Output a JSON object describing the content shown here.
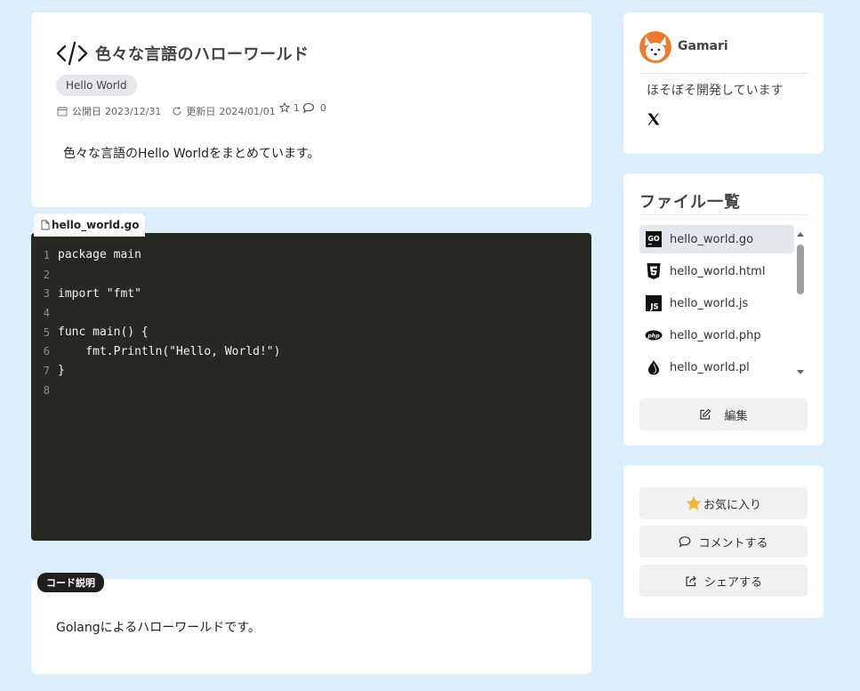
{
  "post": {
    "title": "色々な言語のハローワールド",
    "tag": "Hello World",
    "published_label": "公開日",
    "published_date": "2023/12/31",
    "updated_label": "更新日",
    "updated_date": "2024/01/01",
    "star_count": "1",
    "comment_count": "0",
    "description": "色々な言語のHello Worldをまとめています。"
  },
  "code": {
    "filename": "hello_world.go",
    "lines": [
      {
        "num": "1",
        "text": "package main"
      },
      {
        "num": "2",
        "text": ""
      },
      {
        "num": "3",
        "text": "import \"fmt\""
      },
      {
        "num": "4",
        "text": ""
      },
      {
        "num": "5",
        "text": "func main() {"
      },
      {
        "num": "6",
        "text": "    fmt.Println(\"Hello, World!\")"
      },
      {
        "num": "7",
        "text": "}"
      },
      {
        "num": "8",
        "text": ""
      }
    ]
  },
  "explanation": {
    "badge": "コード説明",
    "text": "Golangによるハローワールドです。"
  },
  "profile": {
    "username": "Gamari",
    "bio": "ほそぼそ開発しています"
  },
  "files": {
    "title": "ファイル一覧",
    "items": [
      {
        "name": "hello_world.go",
        "icon": "go-icon",
        "selected": true
      },
      {
        "name": "hello_world.html",
        "icon": "html5-icon",
        "selected": false
      },
      {
        "name": "hello_world.js",
        "icon": "js-icon",
        "selected": false
      },
      {
        "name": "hello_world.php",
        "icon": "php-icon",
        "selected": false
      },
      {
        "name": "hello_world.pl",
        "icon": "perl-icon",
        "selected": false
      }
    ],
    "edit_label": "編集"
  },
  "actions": {
    "favorite_label": "お気に入り",
    "comment_label": "コメントする",
    "share_label": "シェアする"
  },
  "colors": {
    "background": "#dbeefb",
    "code_bg": "#262822",
    "accent_star": "#f2b632"
  }
}
